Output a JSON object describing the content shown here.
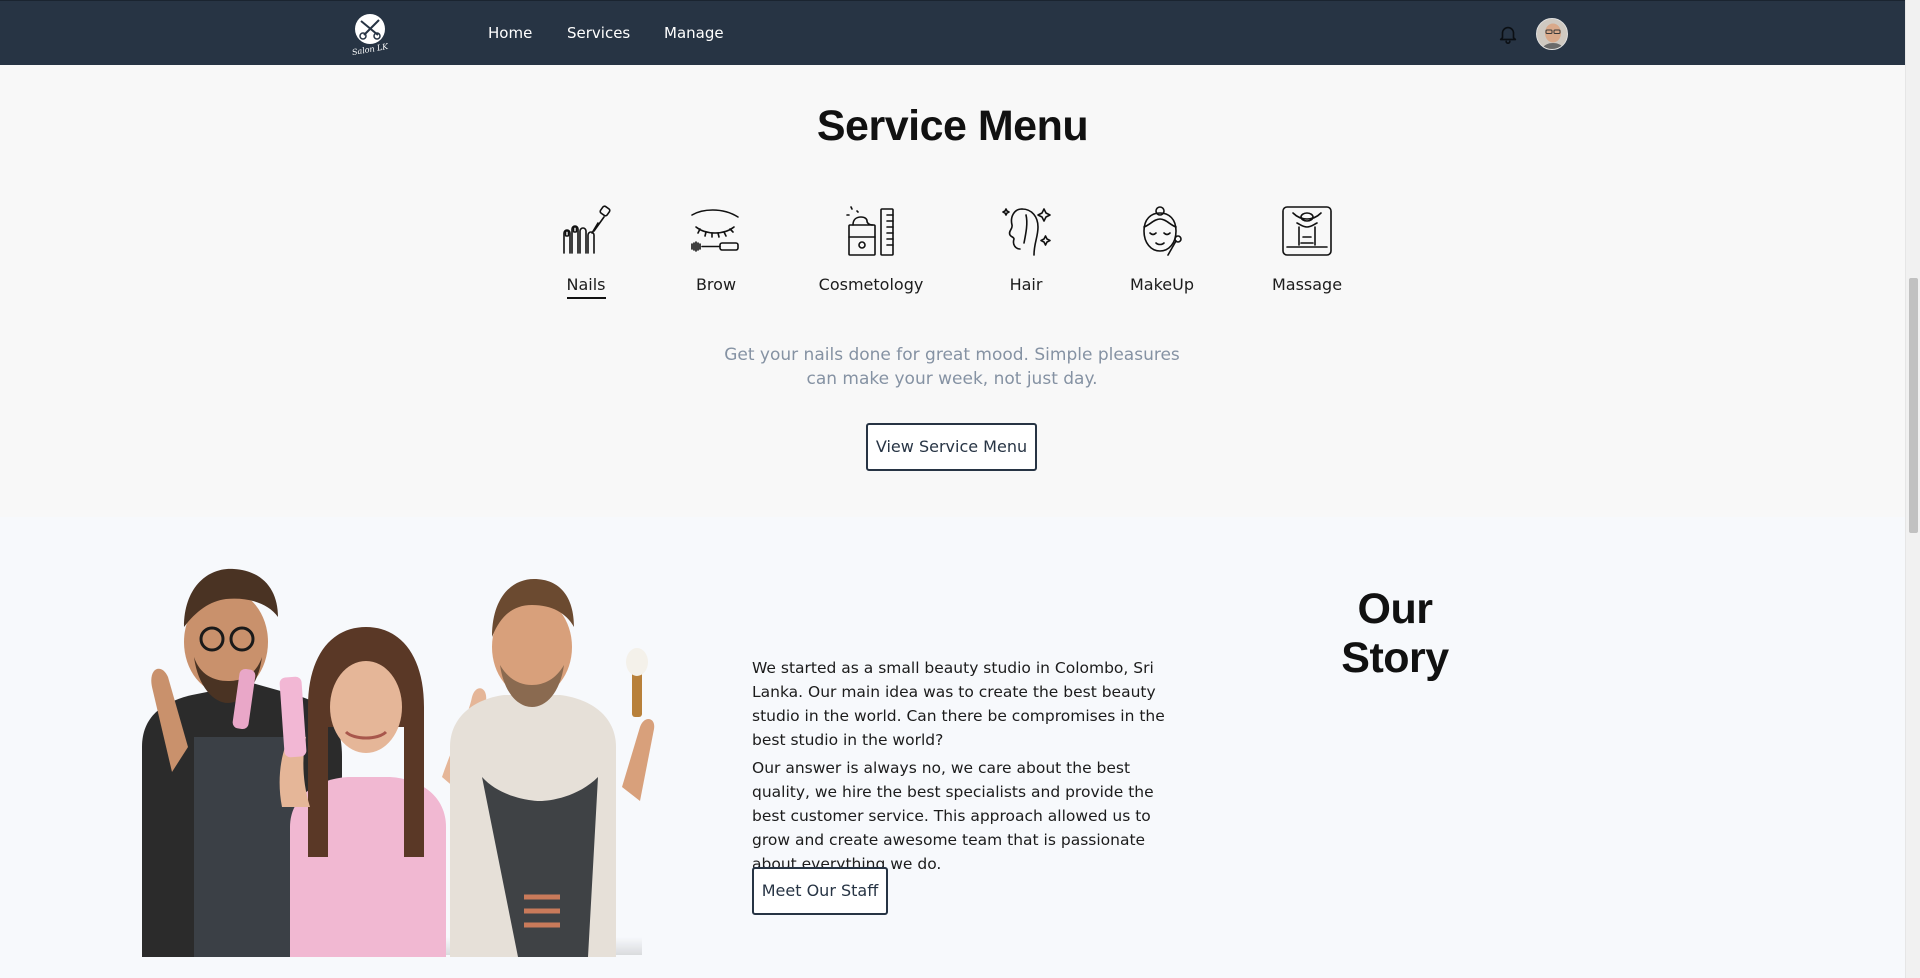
{
  "header": {
    "logo_text": "Salon LK",
    "nav": [
      {
        "label": "Home"
      },
      {
        "label": "Services"
      },
      {
        "label": "Manage"
      }
    ],
    "bell_icon": "bell-icon",
    "avatar_icon": "user-avatar"
  },
  "service_menu": {
    "title": "Service Menu",
    "items": [
      {
        "label": "Nails",
        "icon": "nail-polish-icon",
        "active": true
      },
      {
        "label": "Brow",
        "icon": "eyebrow-icon",
        "active": false
      },
      {
        "label": "Cosmetology",
        "icon": "cosmetics-jar-icon",
        "active": false
      },
      {
        "label": "Hair",
        "icon": "hair-icon",
        "active": false
      },
      {
        "label": "MakeUp",
        "icon": "makeup-face-icon",
        "active": false
      },
      {
        "label": "Massage",
        "icon": "massage-icon",
        "active": false
      }
    ],
    "description": "Get your nails done for great mood. Simple pleasures can make your week, not just day.",
    "button_label": "View Service Menu"
  },
  "story": {
    "title": "Our Story",
    "paragraph_1": "We started as a small beauty studio in Colombo, Sri Lanka. Our main idea was to create the best beauty studio in the world. Can there be compromises in the best studio in the world?",
    "paragraph_2": "Our answer is always no, we care about the best quality, we hire the best specialists and provide the best customer service. This approach allowed us to grow and create awesome team that is passionate about everything we do.",
    "button_label": "Meet Our Staff"
  },
  "colors": {
    "nav_bg": "#273444",
    "page_bg": "#f8f8f8",
    "muted_text": "#8592a3",
    "accent": "#273444"
  }
}
